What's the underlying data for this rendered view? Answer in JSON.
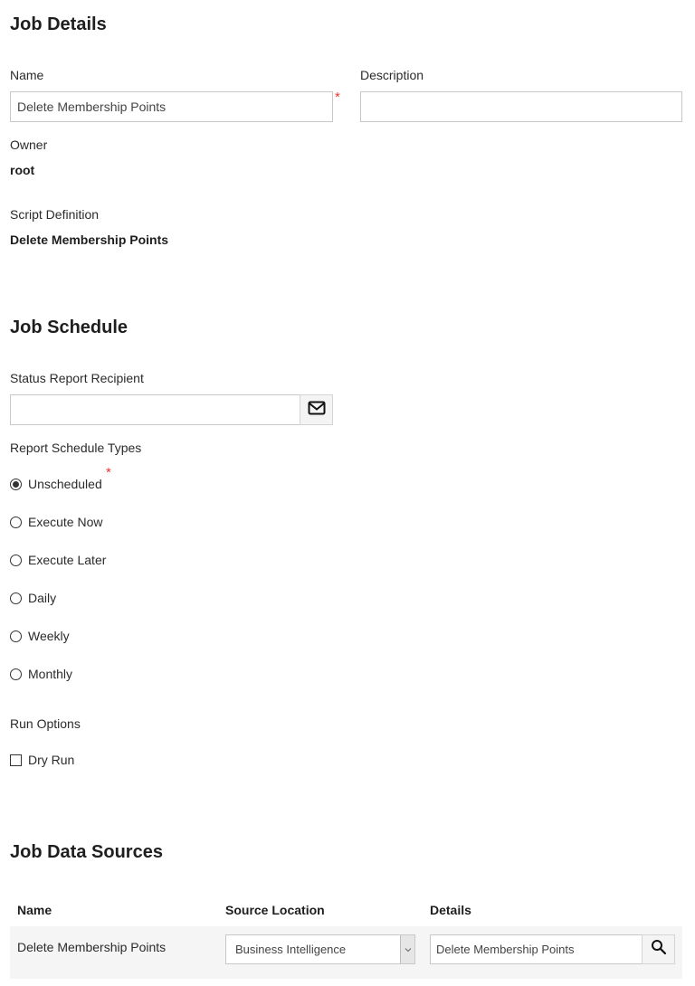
{
  "job_details": {
    "title": "Job Details",
    "name_label": "Name",
    "name_value": "Delete Membership Points",
    "required_mark": "*",
    "description_label": "Description",
    "description_value": "",
    "owner_label": "Owner",
    "owner_value": "root",
    "script_label": "Script Definition",
    "script_value": "Delete Membership Points"
  },
  "job_schedule": {
    "title": "Job Schedule",
    "recipient_label": "Status Report Recipient",
    "recipient_value": "",
    "recipient_icon": "mail-icon",
    "schedule_types_label": "Report Schedule Types",
    "required_mark": "*",
    "options": [
      {
        "label": "Unscheduled",
        "checked": true
      },
      {
        "label": "Execute Now",
        "checked": false
      },
      {
        "label": "Execute Later",
        "checked": false
      },
      {
        "label": "Daily",
        "checked": false
      },
      {
        "label": "Weekly",
        "checked": false
      },
      {
        "label": "Monthly",
        "checked": false
      }
    ],
    "run_options_label": "Run Options",
    "dry_run_label": "Dry Run",
    "dry_run_checked": false
  },
  "job_data_sources": {
    "title": "Job Data Sources",
    "columns": [
      "Name",
      "Source Location",
      "Details"
    ],
    "rows": [
      {
        "name": "Delete Membership Points",
        "source_location": "Business Intelligence",
        "details": "Delete Membership Points",
        "details_icon": "search-icon"
      }
    ]
  },
  "colors": {
    "required": "#e53935",
    "row_background": "#f5f5f5",
    "addon_background": "#f4f4f4"
  }
}
